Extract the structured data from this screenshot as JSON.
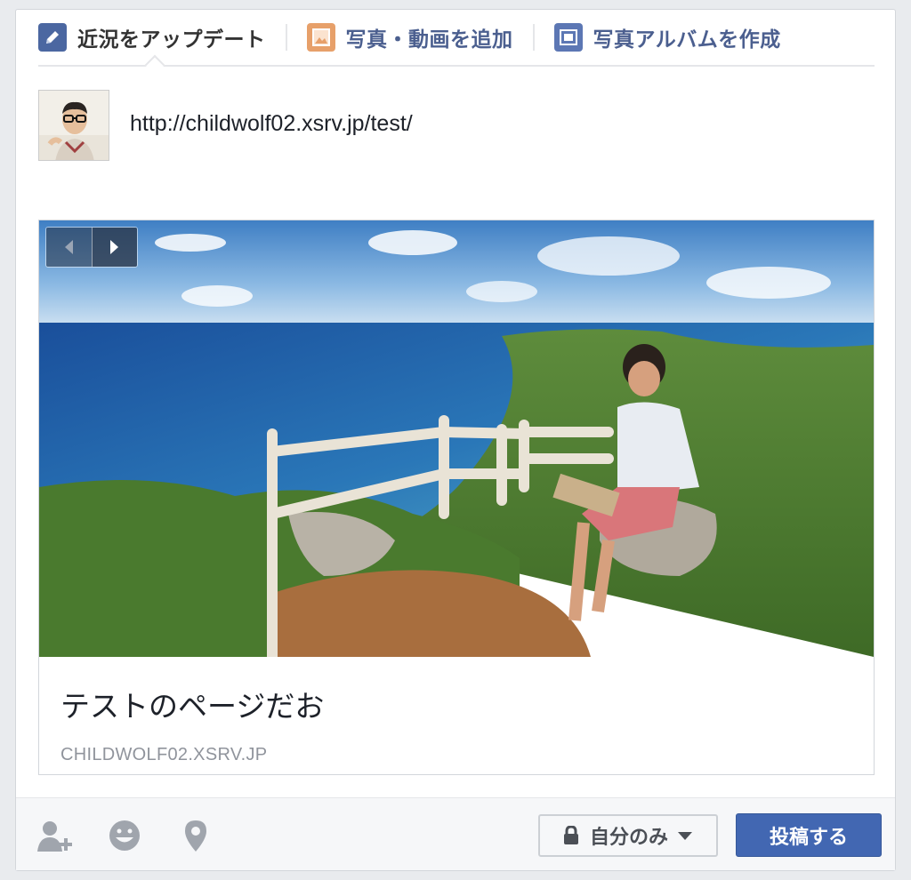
{
  "tabs": [
    {
      "label": "近況をアップデート",
      "icon": "pencil-icon",
      "active": true
    },
    {
      "label": "写真・動画を追加",
      "icon": "photo-icon",
      "active": false
    },
    {
      "label": "写真アルバムを作成",
      "icon": "album-icon",
      "active": false
    }
  ],
  "composer": {
    "status_text": "http://childwolf02.xsrv.jp/test/"
  },
  "preview": {
    "title": "テストのページだお",
    "domain": "CHILDWOLF02.XSRV.JP",
    "prev_icon": "chevron-left-icon",
    "next_icon": "chevron-right-icon"
  },
  "footer": {
    "tag_friends_icon": "add-person-icon",
    "feeling_icon": "smiley-icon",
    "location_icon": "location-pin-icon",
    "privacy_label": "自分のみ",
    "post_label": "投稿する"
  },
  "colors": {
    "brand": "#4267b2",
    "tab_link": "#4b5f8f"
  }
}
